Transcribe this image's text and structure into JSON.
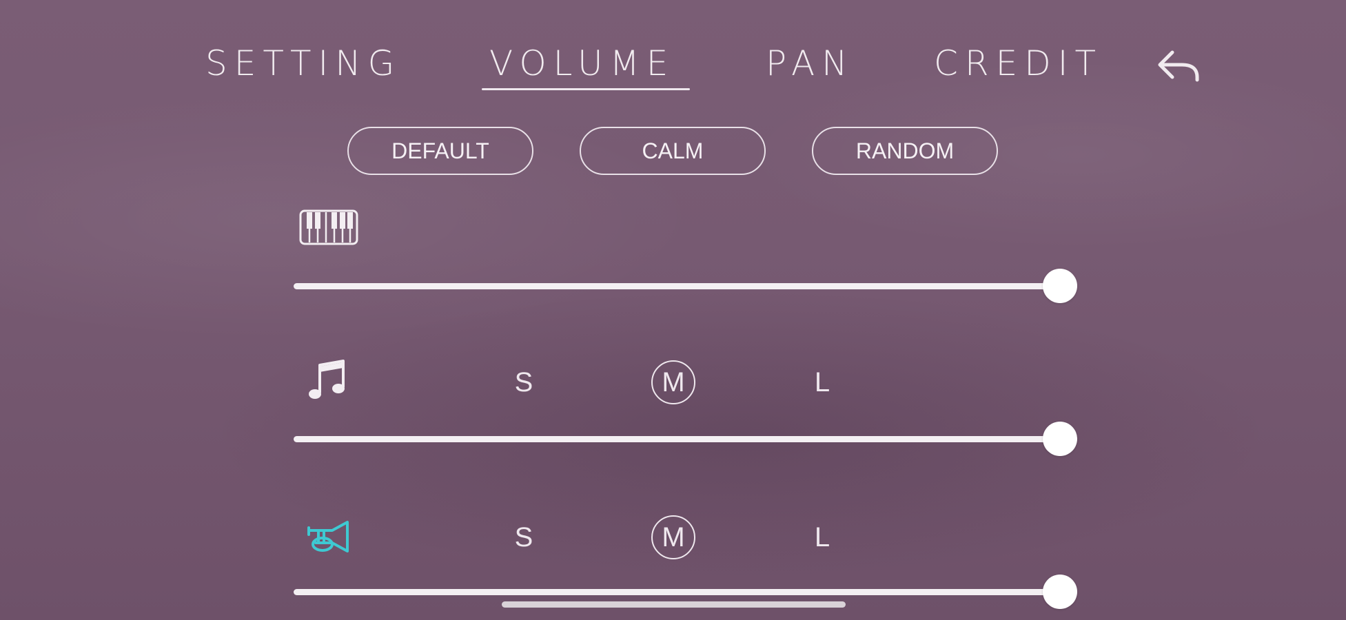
{
  "nav": {
    "tabs": [
      "SETTING",
      "VOLUME",
      "PAN",
      "CREDIT"
    ],
    "active_tab": "VOLUME",
    "back_icon": "back-arrow-icon"
  },
  "presets": [
    "DEFAULT",
    "CALM",
    "RANDOM"
  ],
  "rows": [
    {
      "icon": "piano-icon",
      "volume": 1.0
    },
    {
      "icon": "music-note-icon",
      "sizes": [
        "S",
        "M",
        "L"
      ],
      "selected_size": "M",
      "volume": 1.0
    },
    {
      "icon": "horn-icon",
      "sizes": [
        "S",
        "M",
        "L"
      ],
      "selected_size": "M",
      "volume": 1.0
    }
  ],
  "colors": {
    "background": "#785b73",
    "foreground": "#f3eef2",
    "accent_cyan": "#3ec9d2"
  }
}
